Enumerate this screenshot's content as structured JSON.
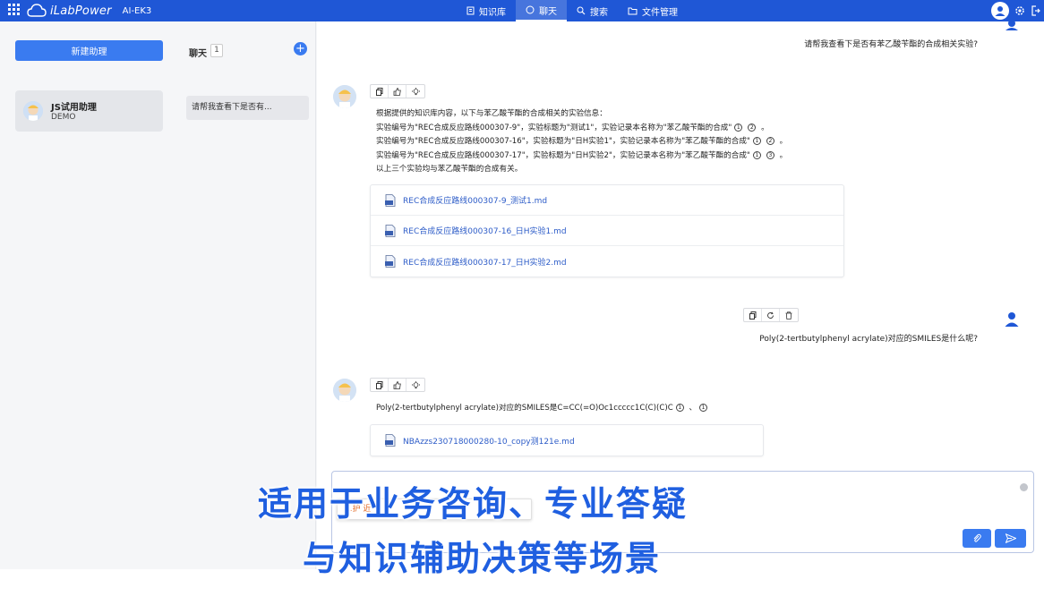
{
  "app": {
    "name": "iLabPower",
    "version": "AI-EK3"
  },
  "nav": {
    "items": [
      {
        "label": "知识库",
        "icon": "book-icon",
        "active": false
      },
      {
        "label": "聊天",
        "icon": "chat-icon",
        "active": true
      },
      {
        "label": "搜索",
        "icon": "search-icon",
        "active": false
      },
      {
        "label": "文件管理",
        "icon": "folder-icon",
        "active": false
      }
    ]
  },
  "sidebar": {
    "new_button": "新建助理",
    "assistant": {
      "name": "JS试用助理",
      "desc": "DEMO"
    }
  },
  "sessions": {
    "title": "聊天",
    "count": "1",
    "items": [
      {
        "label": "请帮我查看下是否有..."
      }
    ]
  },
  "chat": {
    "question1": "请帮我查看下是否有苯乙酸苄酯的合成相关实验?",
    "answer1": {
      "lines": [
        "根据提供的知识库内容，以下与苯乙酸苄酯的合成相关的实验信息：",
        "实验编号为\"REC合成反应路线000307-9\"，实验标题为\"测试1\"，实验记录本名称为\"苯乙酸苄酯的合成\"",
        "实验编号为\"REC合成反应路线000307-16\"，实验标题为\"日H实验1\"，实验记录本名称为\"苯乙酸苄酯的合成\"",
        "实验编号为\"REC合成反应路线000307-17\"，实验标题为\"日H实验2\"，实验记录本名称为\"苯乙酸苄酯的合成\"",
        "以上三个实验均与苯乙酸苄酯的合成有关。"
      ],
      "citations": [
        [
          "1",
          "2"
        ],
        [
          "1",
          "2"
        ],
        [
          "1",
          "3"
        ]
      ]
    },
    "refs1": [
      "REC合成反应路线000307-9_测试1.md",
      "REC合成反应路线000307-16_日H实验1.md",
      "REC合成反应路线000307-17_日H实验2.md"
    ],
    "question2": "Poly(2-tertbutylphenyl acrylate)对应的SMILES是什么呢?",
    "answer2": {
      "text": "Poly(2-tertbutylphenyl acrylate)对应的SMILES是C=CC(=O)Oc1ccccc1C(C)(C)C",
      "citations": [
        "1",
        "1"
      ]
    },
    "refs2": [
      "NBAzzs230718000280-10_copy测121e.md"
    ]
  },
  "input": {
    "value": "",
    "ime_text": "1.护  近"
  },
  "caption": {
    "line1": "适用于业务咨询、专业答疑",
    "line2": "与知识辅助决策等场景"
  },
  "colors": {
    "brand": "#1f57d6",
    "accent": "#3a7bf0",
    "link": "#2d5cc8",
    "caption": "#1f5fe0"
  }
}
